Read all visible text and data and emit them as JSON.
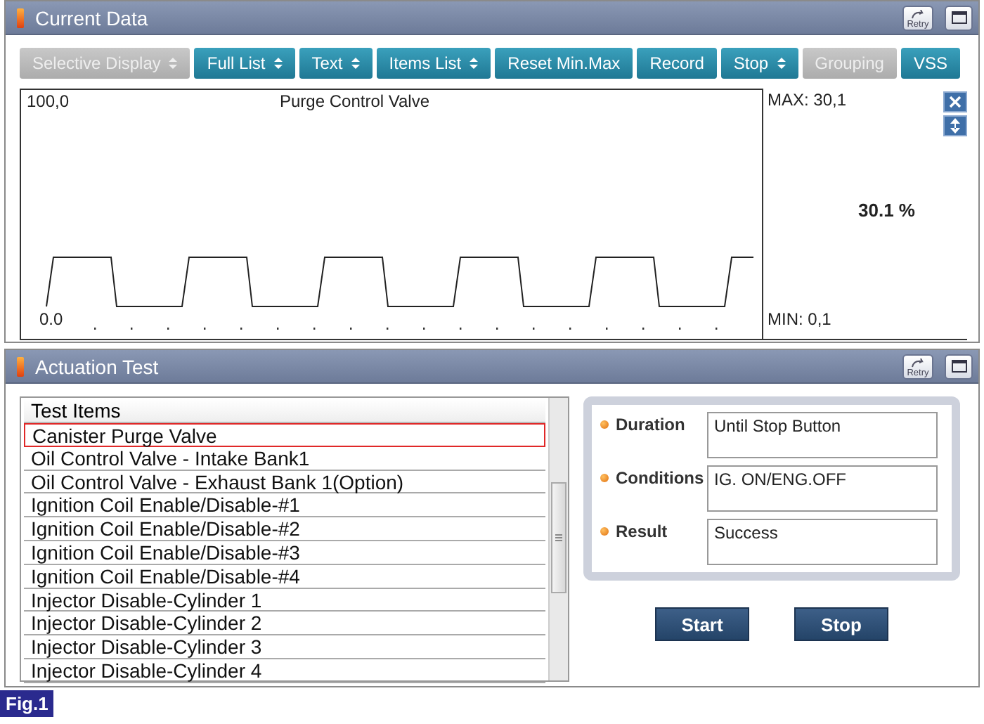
{
  "current_data": {
    "title": "Current Data",
    "retry_label": "Retry",
    "toolbar": [
      {
        "label": "Selective Display",
        "kind": "dropdown",
        "disabled": true
      },
      {
        "label": "Full List",
        "kind": "dropdown",
        "disabled": false
      },
      {
        "label": "Text",
        "kind": "dropdown",
        "disabled": false
      },
      {
        "label": "Items List",
        "kind": "dropdown",
        "disabled": false
      },
      {
        "label": "Reset Min.Max",
        "kind": "button",
        "disabled": false
      },
      {
        "label": "Record",
        "kind": "button",
        "disabled": false
      },
      {
        "label": "Stop",
        "kind": "dropdown",
        "disabled": false
      },
      {
        "label": "Grouping",
        "kind": "button",
        "disabled": true
      },
      {
        "label": "VSS",
        "kind": "button",
        "disabled": false
      }
    ],
    "graph": {
      "title": "Purge Control Valve",
      "y_max_label": "100,0",
      "y_min_label": "0.0",
      "max_reading": "MAX: 30,1",
      "current_value": "30.1 %",
      "min_reading": "MIN: 0,1"
    }
  },
  "actuation_test": {
    "title": "Actuation Test",
    "retry_label": "Retry",
    "list_header": "Test Items",
    "items": [
      {
        "label": "Canister Purge Valve",
        "selected": true
      },
      {
        "label": "Oil Control Valve - Intake Bank1",
        "selected": false
      },
      {
        "label": "Oil Control Valve - Exhaust Bank 1(Option)",
        "selected": false
      },
      {
        "label": "Ignition Coil Enable/Disable-#1",
        "selected": false
      },
      {
        "label": "Ignition Coil Enable/Disable-#2",
        "selected": false
      },
      {
        "label": "Ignition Coil Enable/Disable-#3",
        "selected": false
      },
      {
        "label": "Ignition Coil Enable/Disable-#4",
        "selected": false
      },
      {
        "label": "Injector Disable-Cylinder 1",
        "selected": false
      },
      {
        "label": "Injector Disable-Cylinder 2",
        "selected": false
      },
      {
        "label": "Injector Disable-Cylinder 3",
        "selected": false
      },
      {
        "label": "Injector Disable-Cylinder 4",
        "selected": false
      }
    ],
    "info": [
      {
        "label": "Duration",
        "value": "Until Stop Button"
      },
      {
        "label": "Conditions",
        "value": "IG. ON/ENG.OFF"
      },
      {
        "label": "Result",
        "value": "Success"
      }
    ],
    "buttons": [
      "Start",
      "Stop"
    ]
  },
  "figure_label": "Fig.1"
}
